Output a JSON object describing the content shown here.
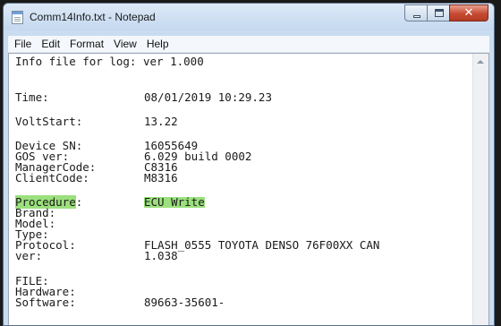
{
  "window": {
    "title": "Comm14Info.txt - Notepad",
    "controls": {
      "minimize": "minimize",
      "maximize": "maximize",
      "close": "✕"
    }
  },
  "menu": [
    "File",
    "Edit",
    "Format",
    "View",
    "Help"
  ],
  "document": {
    "line1": "Info file for log: ver 1.000",
    "time_label": "Time:",
    "time_value": "08/01/2019 10:29.23",
    "voltstart_label": "VoltStart:",
    "voltstart_value": "13.22",
    "device_sn_label": "Device SN:",
    "device_sn_value": "16055649",
    "gos_label": "GOS ver:",
    "gos_value": "6.029 build 0002",
    "manager_label": "ManagerCode:",
    "manager_value": "C8316",
    "client_label": "ClientCode:",
    "client_value": "M8316",
    "procedure_label": "Procedure",
    "procedure_colon": ":",
    "procedure_value": "ECU Write",
    "brand_label": "Brand:",
    "model_label": "Model:",
    "type_label": "Type:",
    "protocol_label": "Protocol:",
    "protocol_value": "FLASH_0555 TOYOTA DENSO 76F00XX CAN",
    "ver_label": "ver:",
    "ver_value": "1.038",
    "file_label": "FILE:",
    "hardware_label": "Hardware:",
    "software_label": "Software:",
    "software_value": "89663-35601-"
  },
  "colors": {
    "highlight": "#9be07d",
    "close_button": "#c74a33",
    "title_bar": "#c9dcf0"
  }
}
